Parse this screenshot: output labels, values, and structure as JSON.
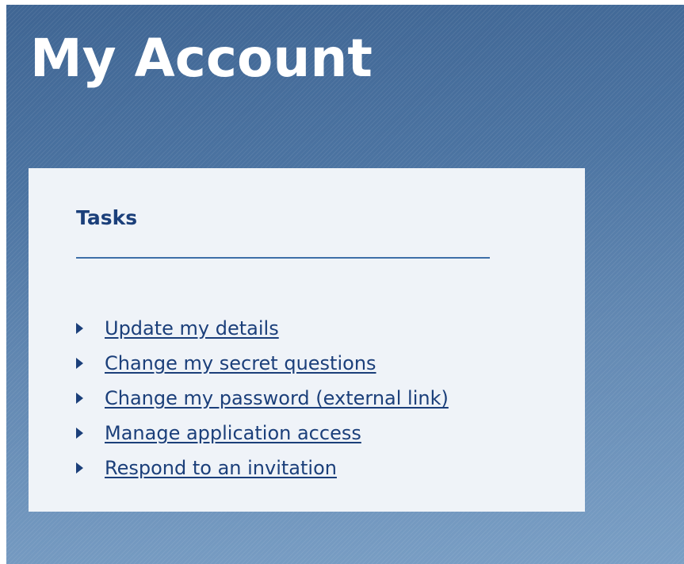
{
  "page": {
    "title": "My Account"
  },
  "tasks": {
    "heading": "Tasks",
    "items": [
      {
        "label": "Update my details"
      },
      {
        "label": "Change my secret questions"
      },
      {
        "label": "Change my password (external link)"
      },
      {
        "label": "Manage application access"
      },
      {
        "label": "Respond to an invitation"
      }
    ]
  },
  "colors": {
    "banner_blue": "#4b73a1",
    "panel_background": "#eff3f8",
    "link_color": "#1b3f7a"
  },
  "icons": {
    "bullet": "triangle-right-icon"
  }
}
